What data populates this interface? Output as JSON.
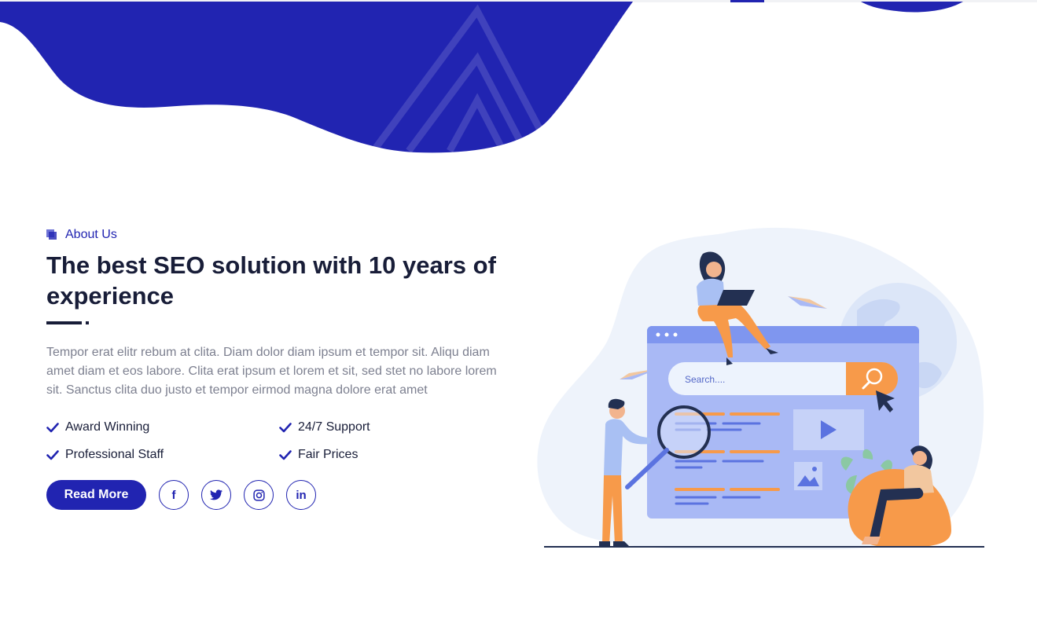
{
  "about": {
    "eyebrow": "About Us",
    "title": "The best SEO solution with 10 years of experience",
    "description": "Tempor erat elitr rebum at clita. Diam dolor diam ipsum et tempor sit. Aliqu diam amet diam et eos labore. Clita erat ipsum et lorem et sit, sed stet no labore lorem sit. Sanctus clita duo justo et tempor eirmod magna dolore erat amet",
    "features": [
      {
        "label": "Award Winning",
        "icon": "check-icon"
      },
      {
        "label": "24/7 Support",
        "icon": "check-icon"
      },
      {
        "label": "Professional Staff",
        "icon": "check-icon"
      },
      {
        "label": "Fair Prices",
        "icon": "check-icon"
      }
    ],
    "read_more": "Read More",
    "social": [
      {
        "name": "facebook",
        "glyph": "f"
      },
      {
        "name": "twitter",
        "icon": "twitter-icon"
      },
      {
        "name": "instagram",
        "icon": "instagram-icon"
      },
      {
        "name": "linkedin",
        "glyph": "in"
      }
    ]
  },
  "illustration": {
    "search_placeholder": "Search...."
  },
  "colors": {
    "primary": "#2124b1",
    "heading": "#181d38",
    "body_text": "#7d8090",
    "accent_orange": "#f79a4a",
    "illustration_blue": "#a9b9f5"
  }
}
